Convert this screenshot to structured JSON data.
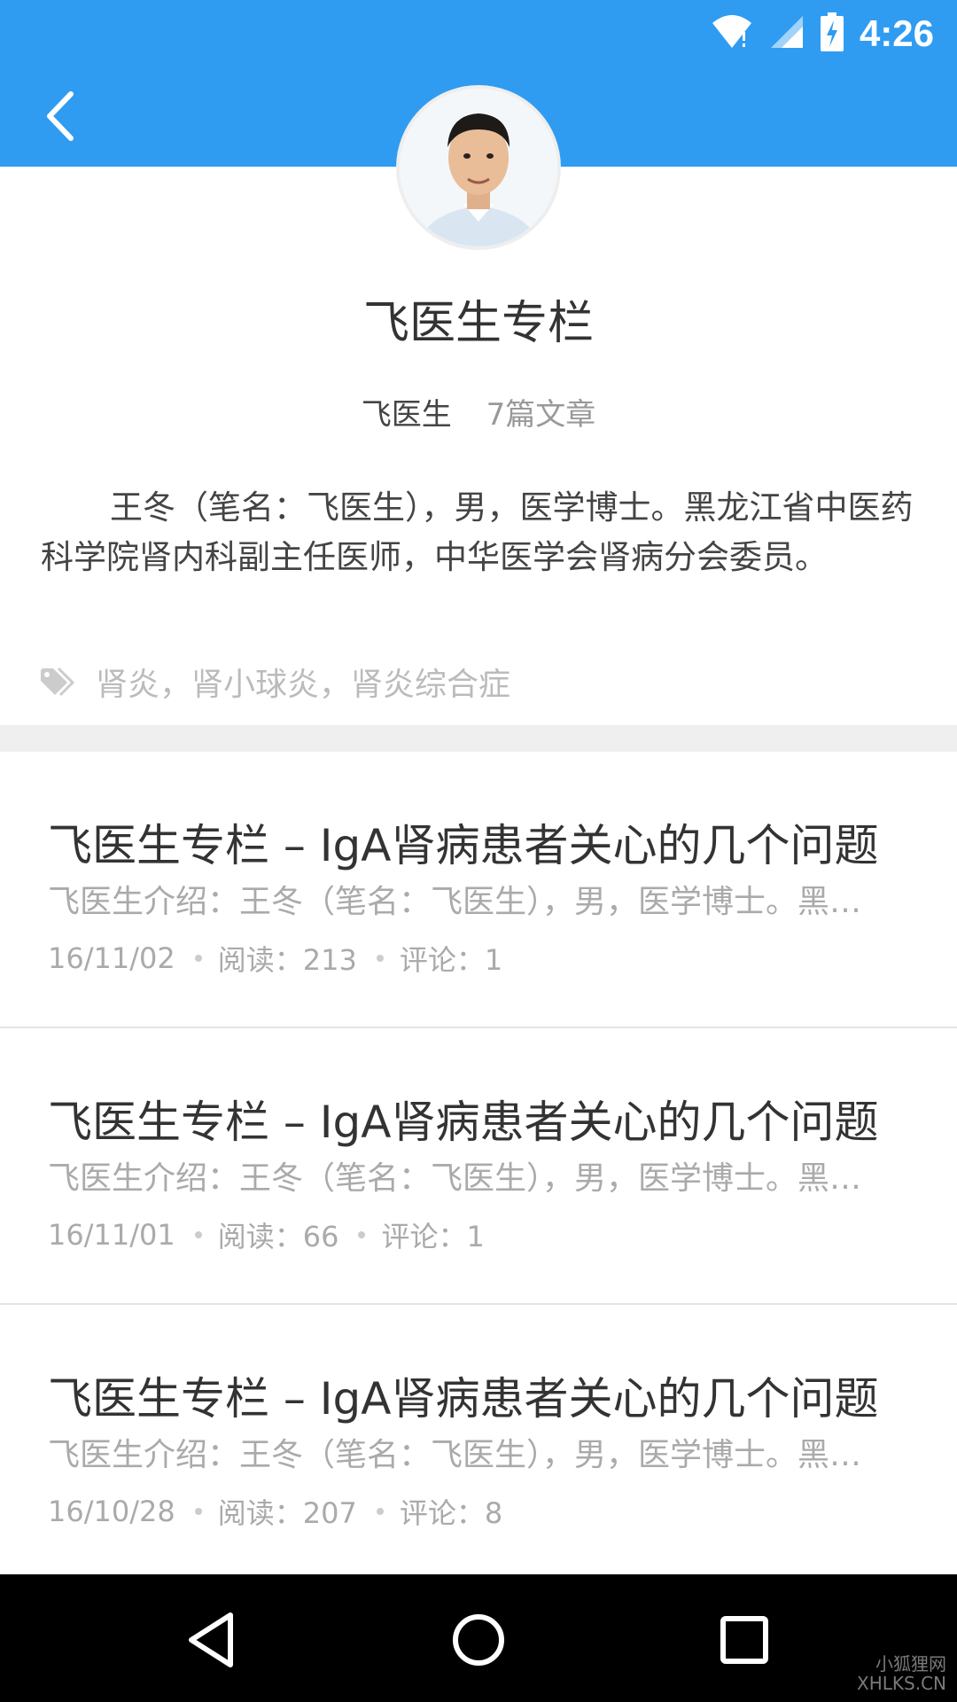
{
  "status_bar": {
    "time": "4:26",
    "icons": [
      "wifi-icon",
      "signal-icon",
      "battery-charging-icon"
    ]
  },
  "header": {
    "back_icon": "chevron-left-icon",
    "bar_color": "#2f9cf2"
  },
  "profile": {
    "title": "飞医生专栏",
    "author": "飞医生",
    "article_count": "7篇文章",
    "bio": "王冬（笔名：飞医生），男，医学博士。黑龙江省中医药科学院肾内科副主任医师，中华医学会肾病分会委员。",
    "tags": "肾炎，肾小球炎，肾炎综合症"
  },
  "articles": [
    {
      "title": "飞医生专栏 – IgA肾病患者关心的几个问题",
      "summary": "飞医生介绍：王冬（笔名：飞医生），男，医学博士。黑龙江省中医药科学院",
      "date": "16/11/02",
      "reads": "阅读：213",
      "comments": "评论：1"
    },
    {
      "title": "飞医生专栏 – IgA肾病患者关心的几个问题",
      "summary": "飞医生介绍：王冬（笔名：飞医生），男，医学博士。黑龙江省中医药科学院",
      "date": "16/11/01",
      "reads": "阅读：66",
      "comments": "评论：1"
    },
    {
      "title": "飞医生专栏 – IgA肾病患者关心的几个问题",
      "summary": "飞医生介绍：王冬（笔名：飞医生），男，医学博士。黑龙江省中医药科学院",
      "date": "16/10/28",
      "reads": "阅读：207",
      "comments": "评论：8"
    }
  ],
  "nav": {
    "back": "nav-back-icon",
    "home": "nav-home-icon",
    "recents": "nav-recents-icon"
  },
  "watermark": {
    "line1": "小狐狸网",
    "line2": "XHLKS.CN"
  }
}
